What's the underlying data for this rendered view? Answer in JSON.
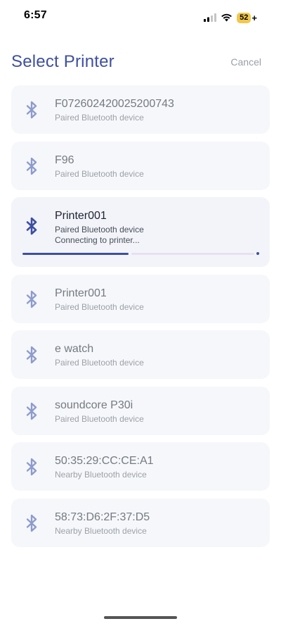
{
  "status_bar": {
    "time": "6:57",
    "battery_level": "52",
    "battery_charging_symbol": "+",
    "icons": [
      "cellular-signal-icon",
      "wifi-icon",
      "battery-icon"
    ]
  },
  "header": {
    "title": "Select Printer",
    "cancel_label": "Cancel"
  },
  "colors": {
    "accent": "#3e4fa1",
    "bluetooth_inactive": "#8d9ccd",
    "card_background": "#f6f7fa",
    "battery": "#f2c84b"
  },
  "devices": [
    {
      "name": "F072602420025200743",
      "type": "Paired Bluetooth device",
      "icon": "bluetooth-icon"
    },
    {
      "name": "F96",
      "type": "Paired Bluetooth device",
      "icon": "bluetooth-icon"
    },
    {
      "name": "Printer001",
      "type": "Paired Bluetooth device",
      "icon": "bluetooth-icon",
      "status": "Connecting to printer...",
      "progress": 0.45
    },
    {
      "name": "Printer001",
      "type": "Paired Bluetooth device",
      "icon": "bluetooth-icon"
    },
    {
      "name": "e watch",
      "type": "Paired Bluetooth device",
      "icon": "bluetooth-icon"
    },
    {
      "name": "soundcore P30i",
      "type": "Paired Bluetooth device",
      "icon": "bluetooth-icon"
    },
    {
      "name": "50:35:29:CC:CE:A1",
      "type": "Nearby Bluetooth device",
      "icon": "bluetooth-icon"
    },
    {
      "name": "58:73:D6:2F:37:D5",
      "type": "Nearby Bluetooth device",
      "icon": "bluetooth-icon"
    }
  ]
}
